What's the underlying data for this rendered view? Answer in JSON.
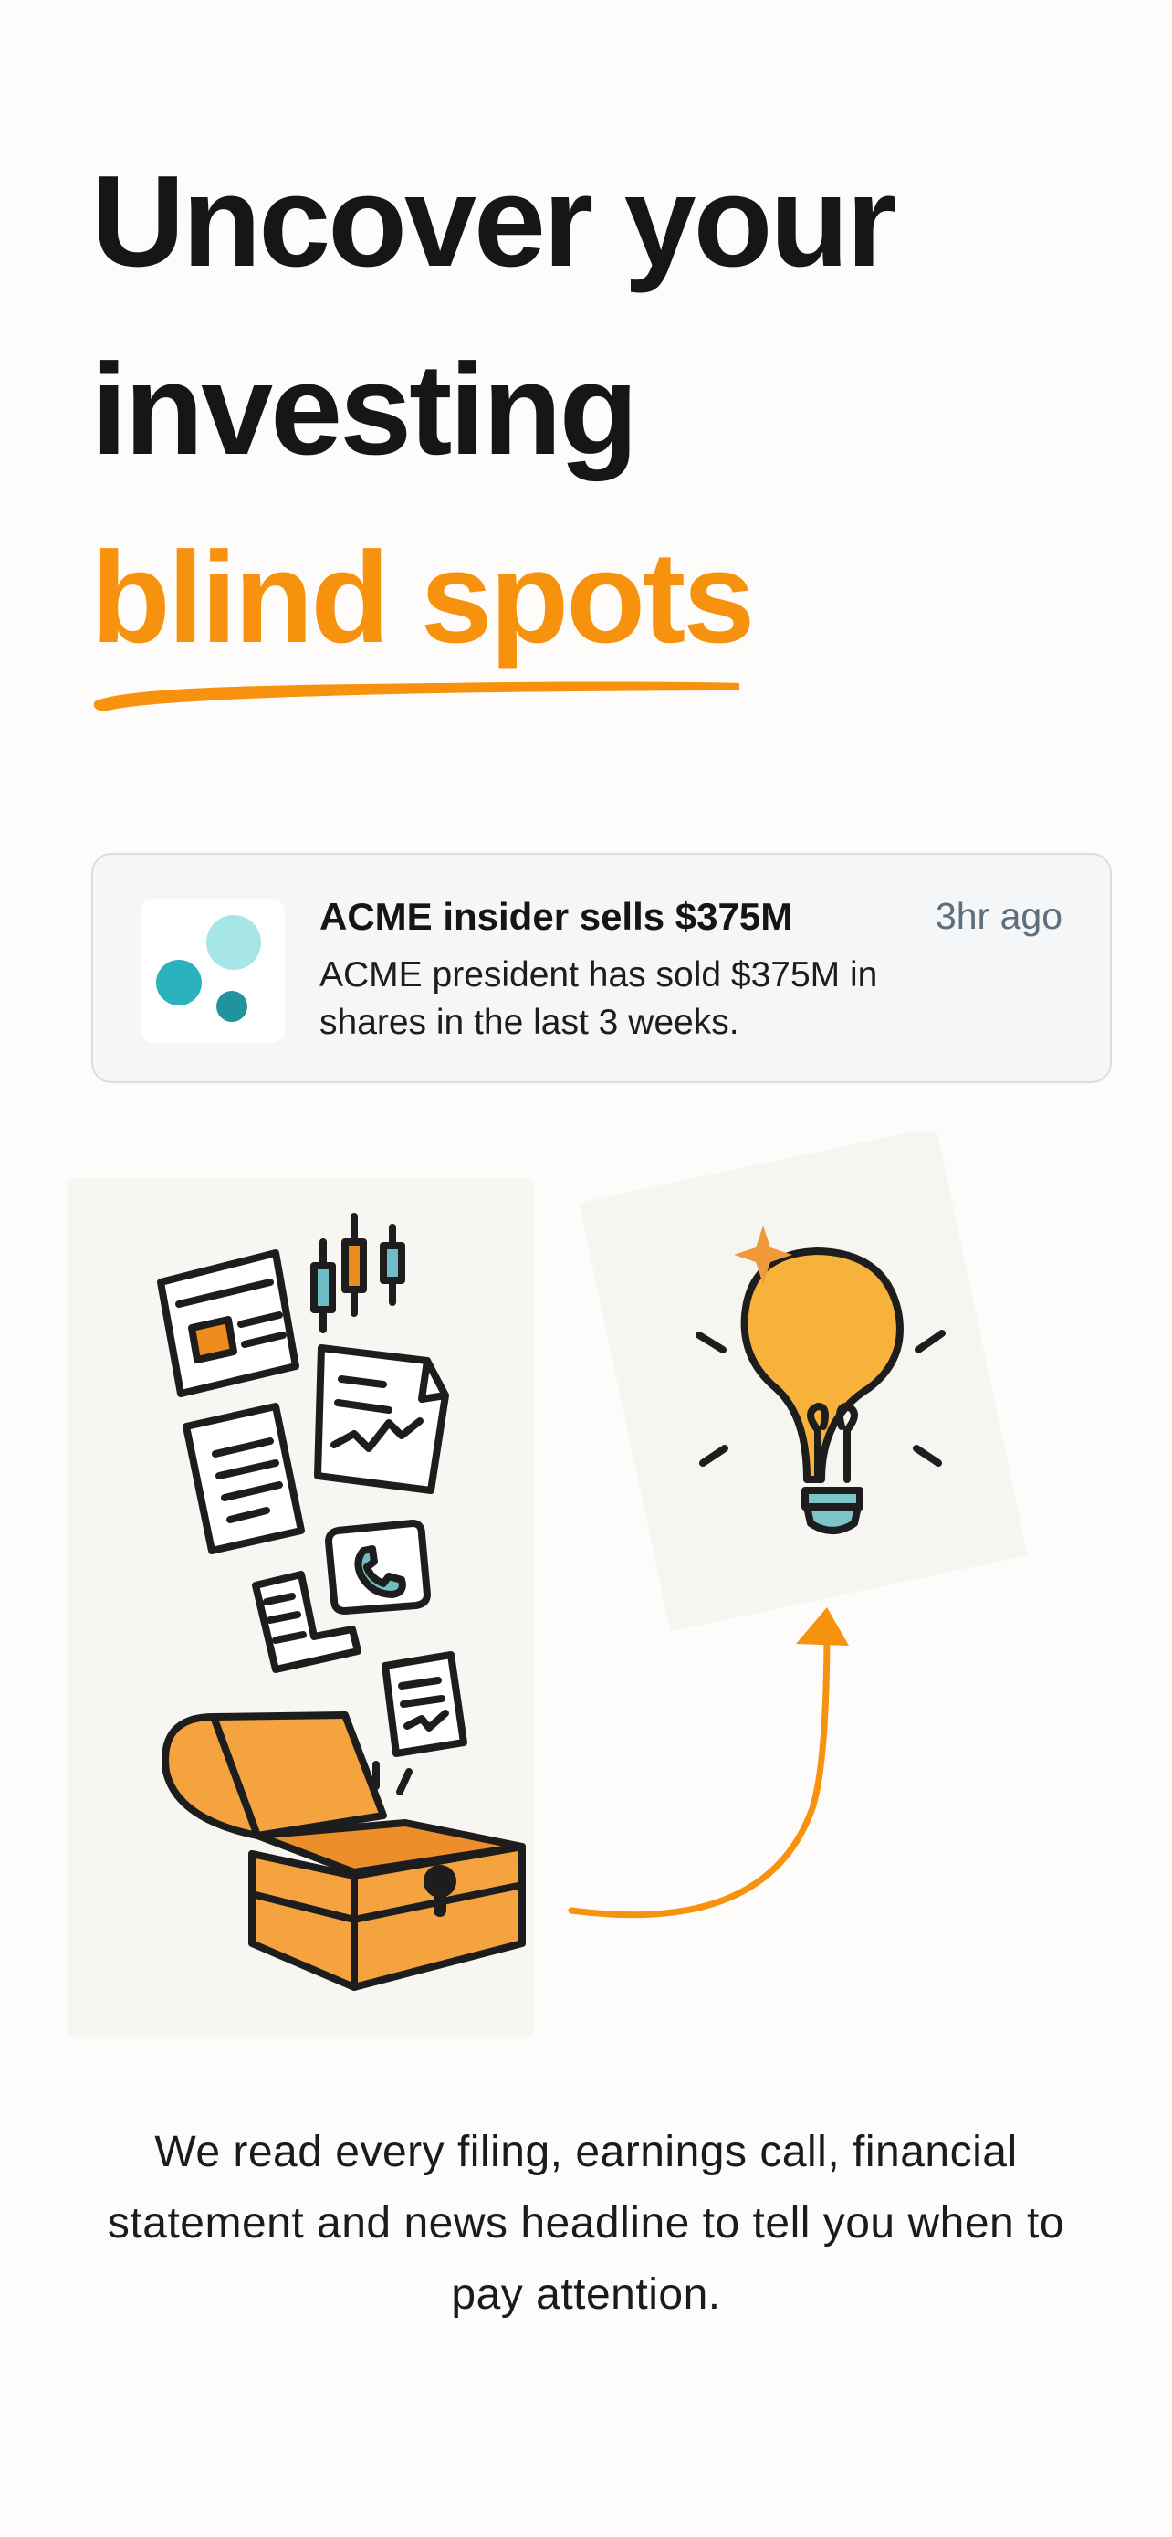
{
  "hero": {
    "line1": "Uncover your",
    "line2": "investing",
    "line3": "blind spots"
  },
  "notification": {
    "title": "ACME insider sells $375M",
    "time": "3hr ago",
    "body": "ACME president has sold $375M in shares in the last 3 weeks.",
    "logo_icon": "acme-dots-logo"
  },
  "illustration": {
    "left_icons": [
      "document-icon",
      "candlestick-chart-icon",
      "line-chart-document-icon",
      "text-document-icon",
      "phone-call-icon",
      "receipt-icon",
      "treasure-chest-icon"
    ],
    "right_icon": "lightbulb-icon",
    "connector": "curved-arrow-icon"
  },
  "caption": "We read every filing, earnings call, financial statement and news headline to tell you when to pay attention.",
  "colors": {
    "accent": "#f7920f",
    "text": "#161616",
    "card_bg": "#f5f6f8",
    "teal": "#2db3be"
  }
}
